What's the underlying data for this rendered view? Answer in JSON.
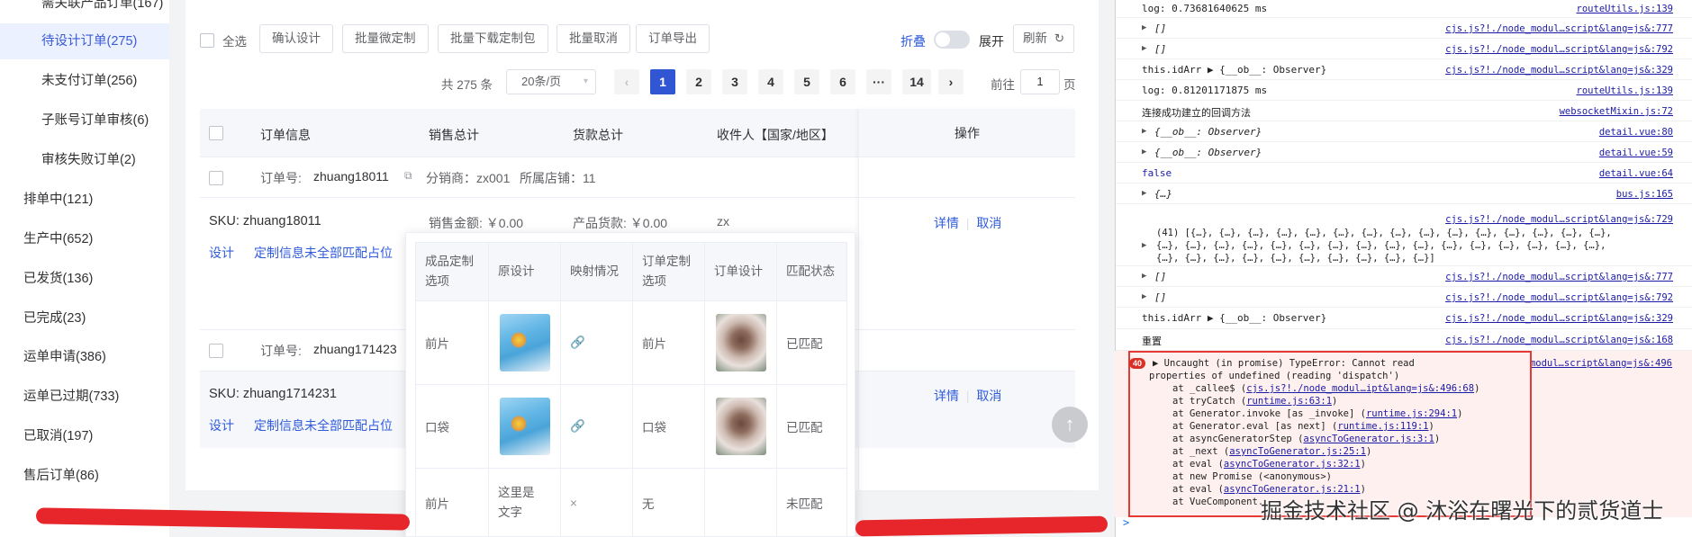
{
  "sidebar": {
    "items": [
      {
        "label": "需关联产品订单(167)"
      },
      {
        "label": "待设计订单(275)"
      },
      {
        "label": "未支付订单(256)"
      },
      {
        "label": "子账号订单审核(6)"
      },
      {
        "label": "审核失败订单(2)"
      },
      {
        "label": "排单中(121)"
      },
      {
        "label": "生产中(652)"
      },
      {
        "label": "已发货(136)"
      },
      {
        "label": "已完成(23)"
      },
      {
        "label": "运单申请(386)"
      },
      {
        "label": "运单已过期(733)"
      },
      {
        "label": "已取消(197)"
      },
      {
        "label": "售后订单(86)"
      }
    ]
  },
  "toolbar": {
    "select_all": "全选",
    "confirm_design": "确认设计",
    "batch_fine_custom": "批量微定制",
    "batch_download": "批量下载定制包",
    "batch_cancel": "批量取消",
    "export": "订单导出",
    "fold": "折叠",
    "expand": "展开",
    "refresh": "刷新"
  },
  "pagination": {
    "total": "共 275 条",
    "page_size": "20条/页",
    "pages": [
      "1",
      "2",
      "3",
      "4",
      "5",
      "6",
      "···",
      "14"
    ],
    "goto": "前往",
    "goto_value": "1",
    "page_unit": "页"
  },
  "table": {
    "headers": {
      "order_info": "订单信息",
      "sales_total": "销售总计",
      "goods_total": "货款总计",
      "receiver": "收件人【国家/地区】",
      "operation": "操作"
    },
    "orders": [
      {
        "order_label": "订单号:",
        "order_no": "zhuang18011",
        "distributor": "分销商：zx001",
        "shop": "所属店铺：11",
        "sku": "SKU: zhuang18011",
        "sales_amount": "销售金额: ￥0.00",
        "goods_amount": "产品货款: ￥0.00",
        "receiver": "zx",
        "design": "设计",
        "warning": "定制信息未全部匹配占位",
        "detail": "详情",
        "cancel": "取消"
      },
      {
        "order_label": "订单号:",
        "order_no": "zhuang171423",
        "sku": "SKU: zhuang1714231",
        "design": "设计",
        "warning": "定制信息未全部匹配占位",
        "detail": "详情",
        "cancel": "取消"
      }
    ]
  },
  "popover": {
    "headers": [
      "成品定制选项",
      "原设计",
      "映射情况",
      "订单定制选项",
      "订单设计",
      "匹配状态"
    ],
    "rows": [
      {
        "option": "前片",
        "original": "",
        "mapping": "link-icon",
        "order_option": "前片",
        "status": "已匹配"
      },
      {
        "option": "口袋",
        "original": "",
        "mapping": "link-icon",
        "order_option": "口袋",
        "status": "已匹配"
      },
      {
        "option": "前片",
        "original": "这里是文字",
        "mapping": "×",
        "order_option": "无",
        "status": "未匹配"
      }
    ]
  },
  "console": {
    "lines": [
      {
        "text": "log: 0.73681640625 ms",
        "src": "routeUtils.js:139"
      },
      {
        "text": "[]",
        "src": "cjs.js?!./node_modul…script&lang=js&:777"
      },
      {
        "text": "[]",
        "src": "cjs.js?!./node_modul…script&lang=js&:792"
      },
      {
        "text": "this.idArr ▶ {__ob__: Observer}",
        "src": "cjs.js?!./node_modul…script&lang=js&:329"
      },
      {
        "text": "log: 0.81201171875 ms",
        "src": "routeUtils.js:139"
      },
      {
        "text": "连接成功建立的回调方法",
        "src": "websocketMixin.js:72"
      },
      {
        "text": "{__ob__: Observer}",
        "src": "detail.vue:80"
      },
      {
        "text": "{__ob__: Observer}",
        "src": "detail.vue:59"
      },
      {
        "text": "false",
        "src": "detail.vue:64"
      },
      {
        "text": "{…}",
        "src": "bus.js:165"
      },
      {
        "text": "(41) [{…}, {…}, {…}, {…}, {…}, {…}, {…}, {…}, {…}, {…}, {…}, {…}, {…}, {…}, {…},",
        "src": "cjs.js?!./node_modul…script&lang=js&:729"
      },
      {
        "text": "{…}, {…}, {…}, {…}, {…}, {…}, {…}, {…}, {…}, {…}, {…}, {…}, {…}, {…}, {…}, {…},",
        "src": ""
      },
      {
        "text": "{…}, {…}, {…}, {…}, {…}, {…}, {…}, {…}, {…}, {…}]",
        "src": ""
      },
      {
        "text": "[]",
        "src": "cjs.js?!./node_modul…script&lang=js&:777"
      },
      {
        "text": "[]",
        "src": "cjs.js?!./node_modul…script&lang=js&:792"
      },
      {
        "text": "this.idArr ▶ {__ob__: Observer}",
        "src": "cjs.js?!./node_modul…script&lang=js&:329"
      },
      {
        "text": "重置",
        "src": "cjs.js?!./node_modul…script&lang=js&:168"
      }
    ],
    "error": {
      "count": "40",
      "title": "▶ Uncaught (in promise) TypeError: Cannot read",
      "title2": "properties of undefined (reading 'dispatch')",
      "src": "cjs.js?!./node_modul…script&lang=js&:496",
      "stack": [
        {
          "prefix": "at _callee$ (",
          "link": "cjs.js?!./node_modul…ipt&lang=js&:496:68",
          "suffix": ")"
        },
        {
          "prefix": "at tryCatch (",
          "link": "runtime.js:63:1",
          "suffix": ")"
        },
        {
          "prefix": "at Generator.invoke [as _invoke] (",
          "link": "runtime.js:294:1",
          "suffix": ")"
        },
        {
          "prefix": "at Generator.eval [as next] (",
          "link": "runtime.js:119:1",
          "suffix": ")"
        },
        {
          "prefix": "at asyncGeneratorStep (",
          "link": "asyncToGenerator.js:3:1",
          "suffix": ")"
        },
        {
          "prefix": "at _next (",
          "link": "asyncToGenerator.js:25:1",
          "suffix": ")"
        },
        {
          "prefix": "at eval (",
          "link": "asyncToGenerator.js:32:1",
          "suffix": ")"
        },
        {
          "prefix": "at new Promise (<anonymous>)",
          "link": "",
          "suffix": ""
        },
        {
          "prefix": "at eval (",
          "link": "asyncToGenerator.js:21:1",
          "suffix": ")"
        },
        {
          "prefix": "at VueComponent.",
          "link": "",
          "suffix": ""
        }
      ]
    },
    "prompt": ">"
  },
  "watermark": "掘金技术社区 @ 沐浴在曙光下的贰货道士"
}
